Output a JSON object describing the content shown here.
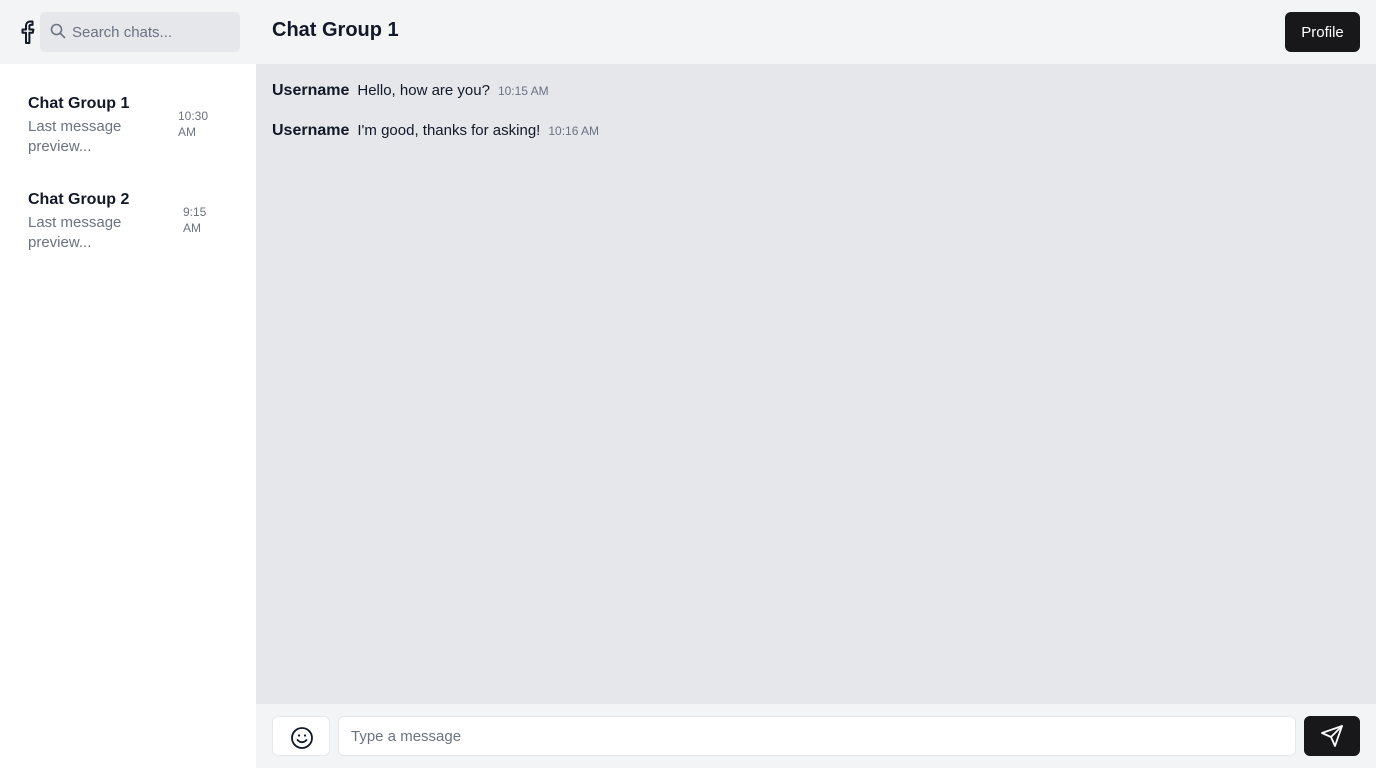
{
  "sidebar": {
    "logo_icon": "facebook-icon",
    "search": {
      "placeholder": "Search chats...",
      "icon": "search-icon"
    },
    "chats": [
      {
        "title": "Chat Group 1",
        "preview": "Last message preview...",
        "time": "10:30 AM"
      },
      {
        "title": "Chat Group 2",
        "preview": "Last message preview...",
        "time": "9:15 AM"
      }
    ]
  },
  "header": {
    "title": "Chat Group 1",
    "profile_label": "Profile"
  },
  "messages": [
    {
      "user": "Username",
      "text": "Hello, how are you?",
      "time": "10:15 AM"
    },
    {
      "user": "Username",
      "text": "I'm good, thanks for asking!",
      "time": "10:16 AM"
    }
  ],
  "composer": {
    "placeholder": "Type a message",
    "emoji_icon": "smile-icon",
    "send_icon": "send-icon"
  },
  "colors": {
    "header_bg": "#f3f4f6",
    "messages_bg": "#e5e7eb",
    "button_dark": "#18181b",
    "muted_text": "#6b7280"
  }
}
